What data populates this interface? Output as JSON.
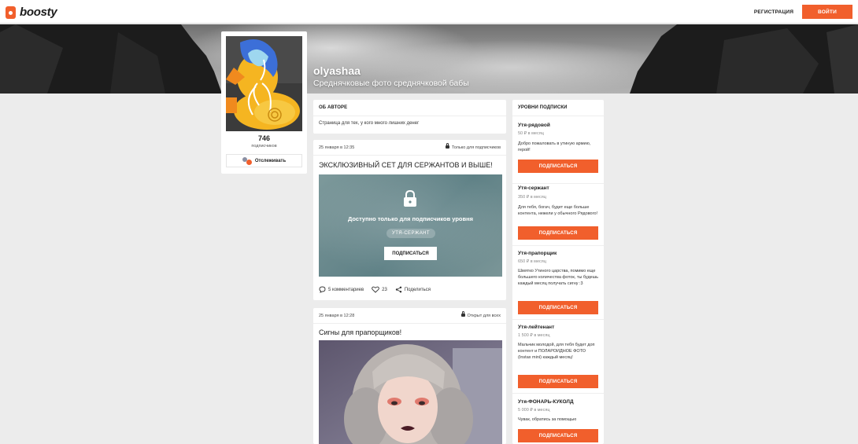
{
  "header": {
    "logo_text": "boosty",
    "register_label": "РЕГИСТРАЦИЯ",
    "login_label": "ВОЙТИ"
  },
  "colors": {
    "accent": "#f15f2c",
    "page_bg": "#ececec"
  },
  "profile": {
    "name": "olyashaa",
    "tagline": "Среднячковые фото среднячковой бабы",
    "subscribers_count": "746",
    "subscribers_label": "подписчиков",
    "follow_label": "Отслеживать"
  },
  "about": {
    "heading": "ОБ АВТОРЕ",
    "text": "Страница для тех, у кого много лишних денег"
  },
  "posts": [
    {
      "date": "25 января в 12:35",
      "access": "Только для подписчиков",
      "title": "ЭКСКЛЮЗИВНЫЙ СЕТ ДЛЯ СЕРЖАНТОВ И ВЫШЕ!",
      "locked_text": "Доступно только для подписчиков уровня",
      "level": "УТЯ-СЕРЖАНТ",
      "subscribe_label": "ПОДПИСАТЬСЯ",
      "comments": "5 комментариев",
      "likes": "23",
      "share": "Поделиться"
    },
    {
      "date": "25 января в 12:28",
      "access": "Открыт для всех",
      "title": "Сигны для прапорщиков!"
    }
  ],
  "tiers_heading": "УРОВНИ ПОДПИСКИ",
  "tiers": [
    {
      "name": "Утя-рядовой",
      "price": "50 ₽ в месяц",
      "desc": "Добро пожаловать в утиную армию, герой!",
      "button": "ПОДПИСАТЬСЯ"
    },
    {
      "name": "Утя-сержант",
      "price": "350 ₽ в месяц",
      "desc": "Для тебя, богач, будет еще больше контента, нежели у обычного Рядового!",
      "button": "ПОДПИСАТЬСЯ"
    },
    {
      "name": "Утя-прапорщик",
      "price": "650 ₽ в месяц",
      "desc": "Шмятко Утиного царства, помимо еще большего количества фоток, ты будешь каждый месяц получать сигну :3",
      "button": "ПОДПИСАТЬСЯ"
    },
    {
      "name": "Утя-лейтенант",
      "price": "1 500 ₽ в месяц",
      "desc": "Мальчик молодой, для тебя будет доп контент и ПОЛАРОИДНОЕ ФОТО (Instax mini) каждый месяц!",
      "button": "ПОДПИСАТЬСЯ"
    },
    {
      "name": "Утя-ФОНАРЬ-КУКОЛД",
      "price": "5 000 ₽ в месяц",
      "desc": "Чувак, обратись за помощью",
      "button": "ПОДПИСАТЬСЯ"
    }
  ]
}
